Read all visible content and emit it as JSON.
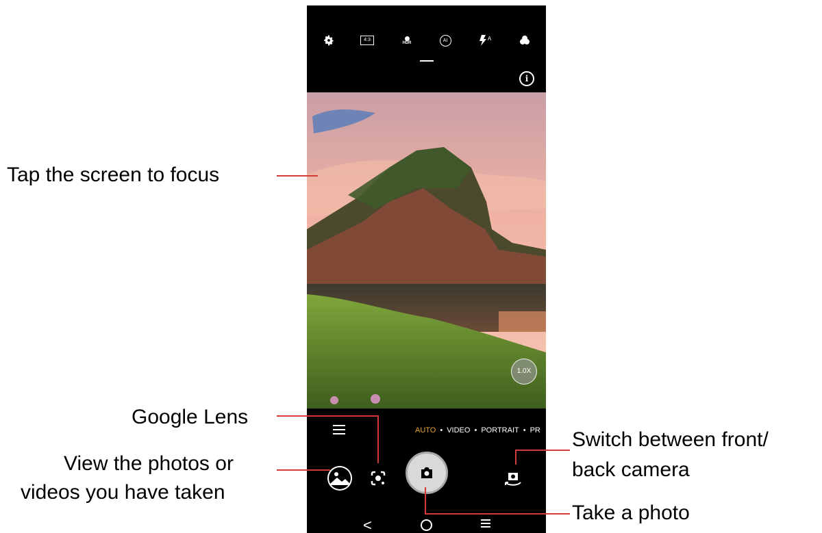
{
  "camera": {
    "top_icons": [
      "gear-icon",
      "aspect-ratio-icon",
      "hdr-icon",
      "ai-scene-icon",
      "flash-auto-icon",
      "filter-icon"
    ],
    "aspect_label": "4:3",
    "hdr_label": "HDR",
    "ai_label": "AI",
    "flash_label": "A",
    "info_label": "i",
    "zoom_label": "1.0X",
    "modes": {
      "auto": "AUTO",
      "video": "VIDEO",
      "portrait": "PORTRAIT",
      "more": "PR"
    },
    "nav": {
      "back": "<"
    }
  },
  "callouts": {
    "focus": "Tap the screen to focus",
    "lens": "Google Lens",
    "gallery_line1": "View the photos or",
    "gallery_line2": "videos you have taken",
    "switch_line1": "Switch between front/",
    "switch_line2": "back camera",
    "shutter": "Take a photo"
  },
  "colors": {
    "callout_line": "#d33a3a",
    "active_mode": "#e8a33a"
  }
}
